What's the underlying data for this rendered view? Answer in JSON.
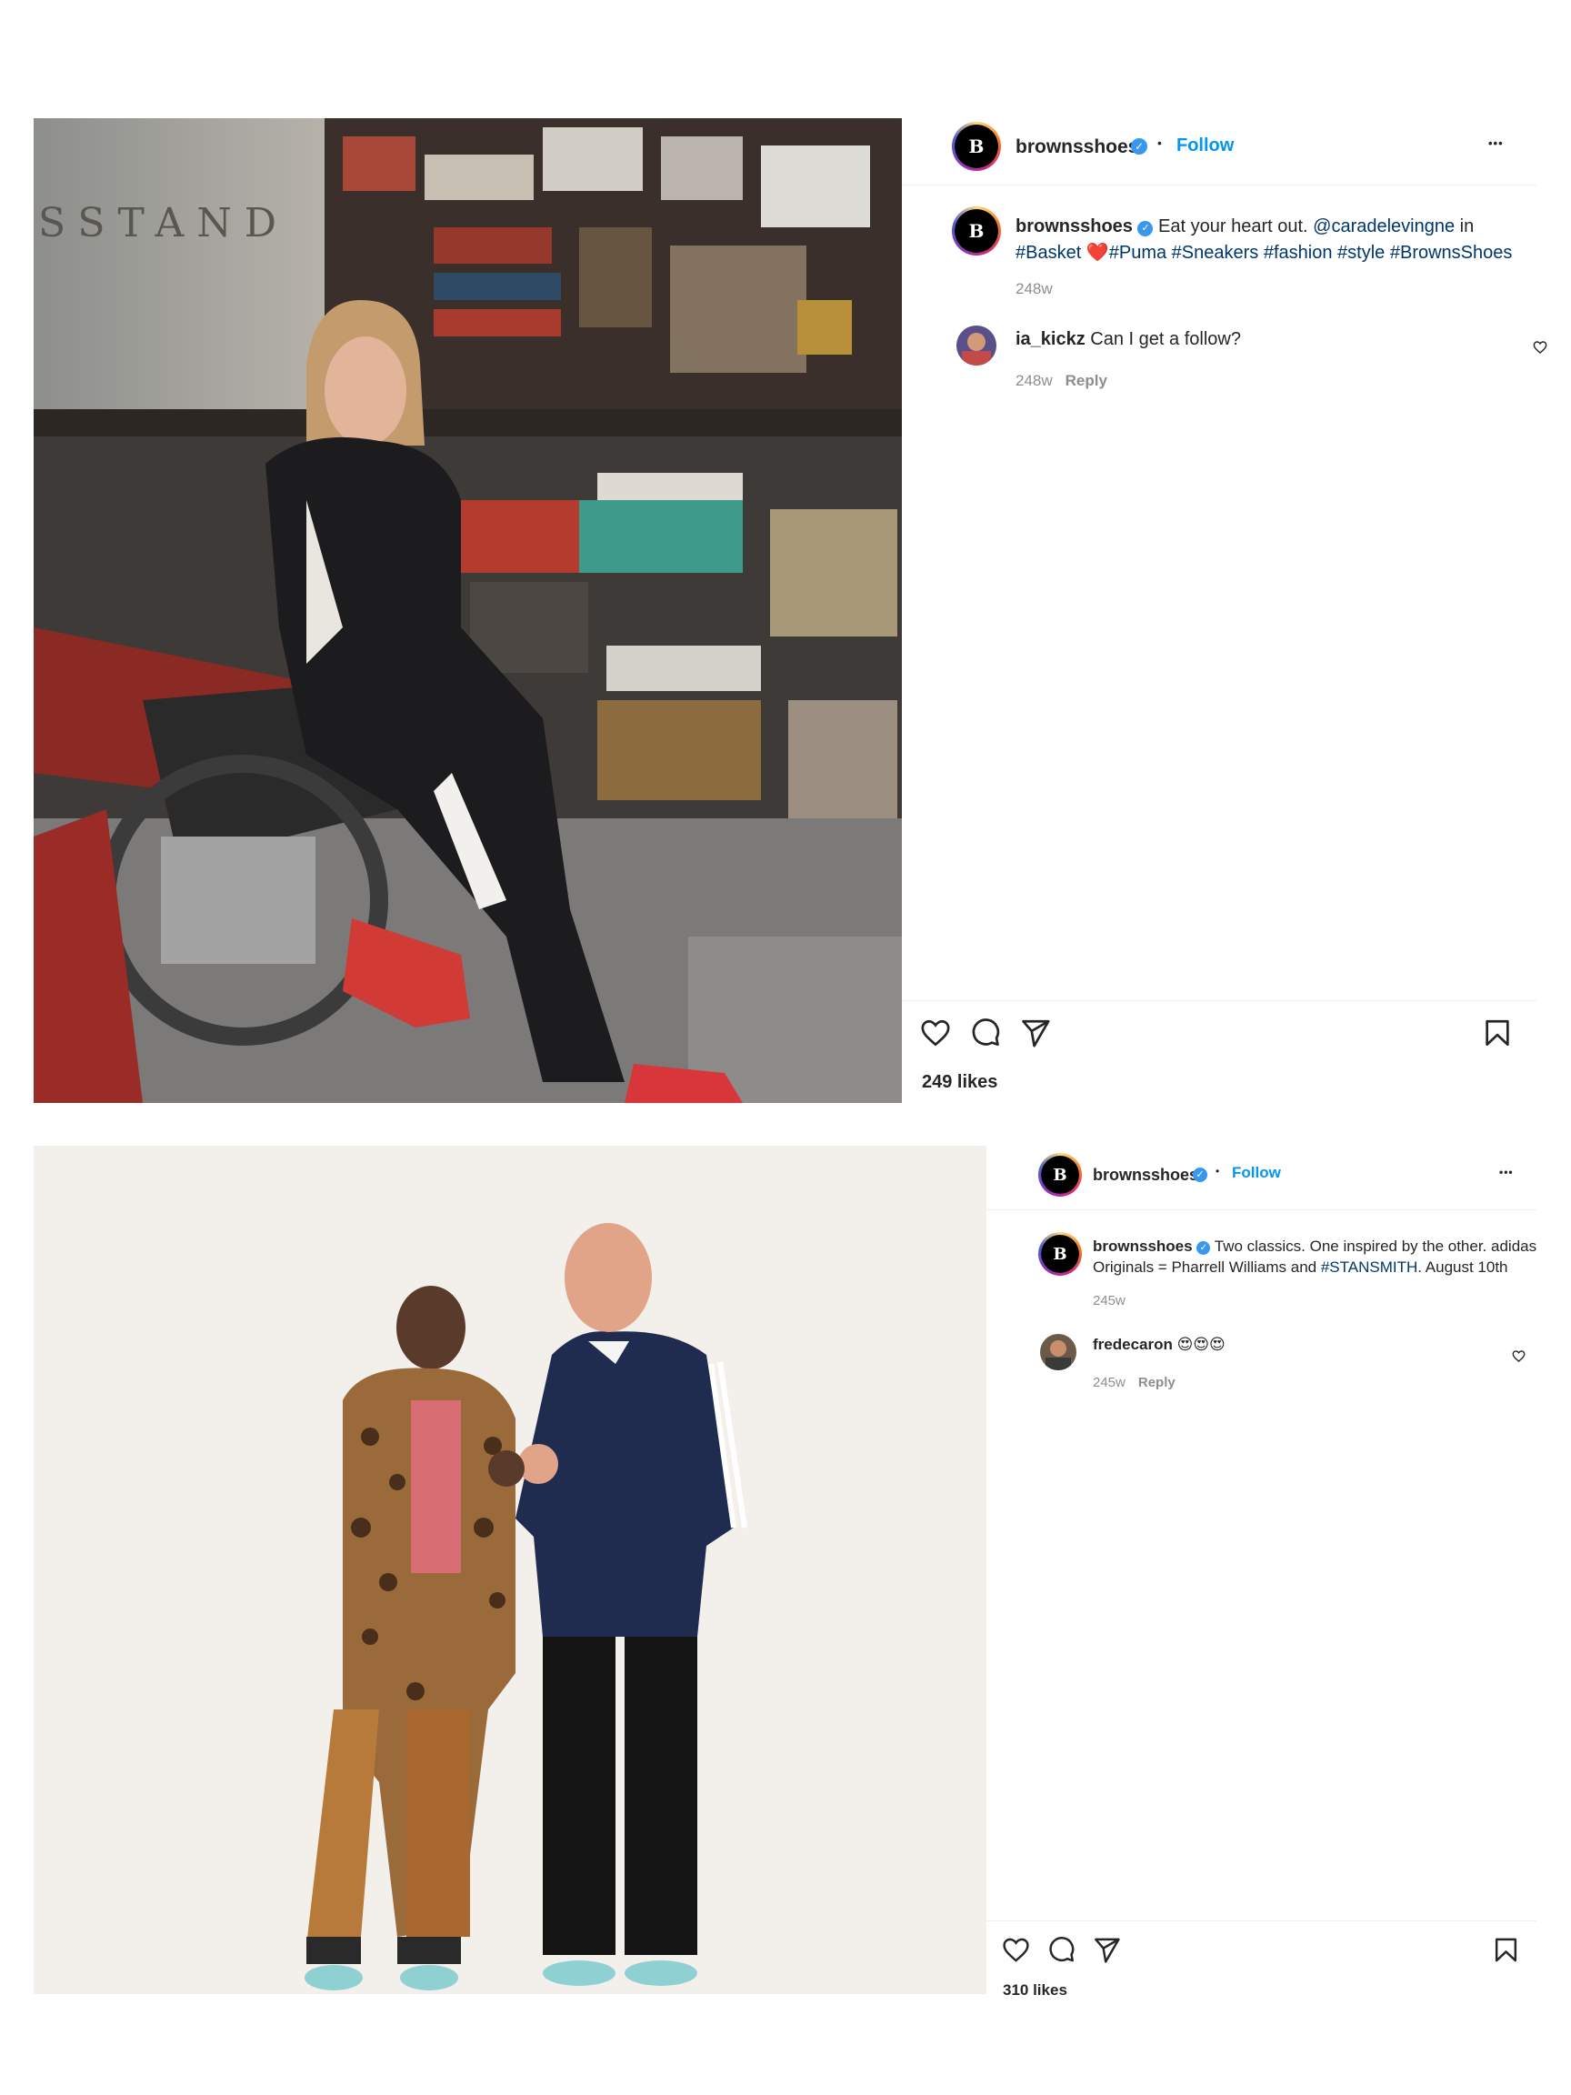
{
  "posts": [
    {
      "account": {
        "username": "brownsshoes",
        "avatar_letter": "B",
        "follow_label": "Follow",
        "separator": "•",
        "more": "•••"
      },
      "caption": {
        "username": "brownsshoes",
        "parts": [
          {
            "text": "Eat your heart out. ",
            "type": "text"
          },
          {
            "text": "@caradelevingne",
            "type": "mention"
          },
          {
            "text": " in ",
            "type": "text"
          },
          {
            "text": "#Basket",
            "type": "tag"
          },
          {
            "text": " ",
            "type": "text"
          },
          {
            "text": "❤️",
            "type": "emoji"
          },
          {
            "text": "#Puma",
            "type": "tag"
          },
          {
            "text": " ",
            "type": "text"
          },
          {
            "text": "#Sneakers",
            "type": "tag"
          },
          {
            "text": " ",
            "type": "text"
          },
          {
            "text": "#fashion",
            "type": "tag"
          },
          {
            "text": " ",
            "type": "text"
          },
          {
            "text": "#style",
            "type": "tag"
          },
          {
            "text": " ",
            "type": "text"
          },
          {
            "text": "#BrownsShoes",
            "type": "tag"
          }
        ],
        "time": "248w"
      },
      "comment": {
        "username": "ia_kickz",
        "text": "Can I get a follow?",
        "time": "248w",
        "reply": "Reply"
      },
      "likes": "249 likes",
      "icons": {
        "like": "heart-icon",
        "comment": "comment-icon",
        "share": "share-icon",
        "save": "bookmark-icon",
        "comment_like": "heart-icon"
      }
    },
    {
      "account": {
        "username": "brownsshoes",
        "avatar_letter": "B",
        "follow_label": "Follow",
        "separator": "•",
        "more": "•••"
      },
      "caption": {
        "username": "brownsshoes",
        "parts": [
          {
            "text": "Two classics. One inspired by the other. adidas Originals = Pharrell Williams and ",
            "type": "text"
          },
          {
            "text": "#STANSMITH",
            "type": "tag"
          },
          {
            "text": ". August 10th",
            "type": "text"
          }
        ],
        "time": "245w"
      },
      "comment": {
        "username": "fredecaron",
        "text": "😍😍😍",
        "time": "245w",
        "reply": "Reply"
      },
      "likes": "310 likes",
      "icons": {
        "like": "heart-icon",
        "comment": "comment-icon",
        "share": "share-icon",
        "save": "bookmark-icon",
        "comment_like": "heart-icon"
      }
    }
  ],
  "colors": {
    "link": "#00376b",
    "follow": "#0095f6",
    "muted": "#8e8e8e",
    "verified": "#3897f0"
  }
}
